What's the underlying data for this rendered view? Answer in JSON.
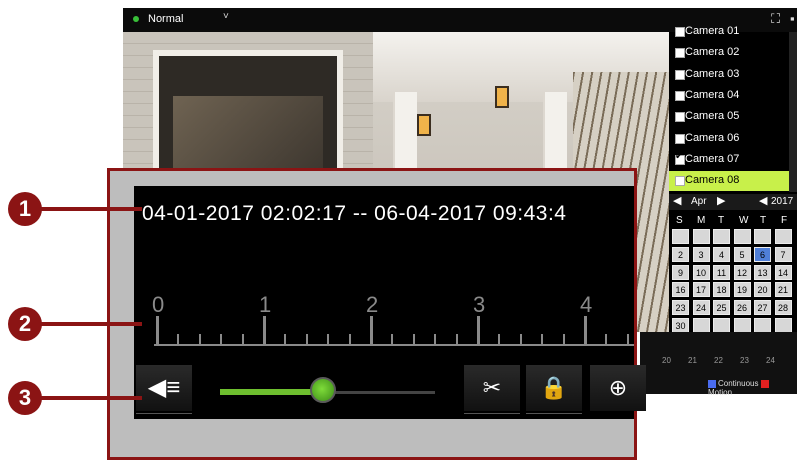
{
  "nvr": {
    "mode": "Normal",
    "cameras": [
      "Camera 01",
      "Camera 02",
      "Camera 03",
      "Camera 04",
      "Camera 05",
      "Camera 06",
      "Camera 07",
      "Camera 08"
    ],
    "checked_camera": "Camera 07",
    "selected_camera": "Camera 08",
    "calendar": {
      "month": "Apr",
      "year": "2017",
      "weekdays": [
        "S",
        "M",
        "T",
        "W",
        "T",
        "F"
      ],
      "selected_day": "6",
      "rows": [
        [
          "",
          "",
          "",
          "",
          "",
          ""
        ],
        [
          "2",
          "3",
          "4",
          "5",
          "6",
          "7"
        ],
        [
          "9",
          "10",
          "11",
          "12",
          "13",
          "14"
        ],
        [
          "16",
          "17",
          "18",
          "19",
          "20",
          "21"
        ],
        [
          "23",
          "24",
          "25",
          "26",
          "27",
          "28"
        ],
        [
          "30",
          "",
          "",
          "",
          "",
          ""
        ]
      ]
    },
    "mini_timeline_ticks": [
      "20",
      "21",
      "22",
      "23",
      "24"
    ],
    "legend": [
      {
        "label": "Continuous",
        "color": "#4a6cf0"
      },
      {
        "label": "Motion",
        "color": "#e02020"
      }
    ]
  },
  "callout": {
    "time_range": "04-01-2017 02:02:17 -- 06-04-2017 09:43:4",
    "ruler_ticks": [
      "0",
      "1",
      "2",
      "3",
      "4"
    ],
    "volume_level": 0.48,
    "accent_color": "#8b1414",
    "slider_color": "#6ebf2f"
  },
  "badges": [
    "1",
    "2",
    "3"
  ]
}
